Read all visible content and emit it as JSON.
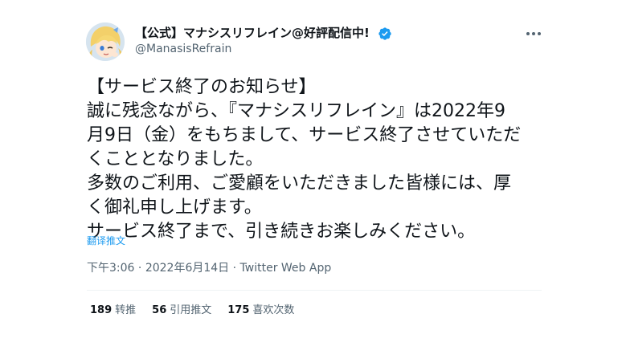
{
  "author": {
    "display_name": "【公式】マナシスリフレイン@好評配信中!",
    "handle": "@ManasisRefrain",
    "avatar_icon": "anime-character-avatar",
    "verified_icon": "verified-badge-icon",
    "verified_color": "#1d9bf0"
  },
  "tweet": {
    "lines": [
      "【サービス終了のお知らせ】",
      "誠に残念ながら、『マナシスリフレイン』は2022年9",
      "月9日（金）をもちまして、サービス終了させていただ",
      "くこととなりました。",
      "多数のご利用、ご愛顧をいただきました皆様には、厚",
      "く御礼申し上げます。",
      "サービス終了まで、引き続きお楽しみください。"
    ],
    "translate_label": "翻译推文",
    "time": "下午3:06",
    "date": "2022年6月14日",
    "separator": "·",
    "source": "Twitter Web App"
  },
  "stats": {
    "retweets_count": "189",
    "retweets_label": "转推",
    "quotes_count": "56",
    "quotes_label": "引用推文",
    "likes_count": "175",
    "likes_label": "喜欢次数"
  },
  "colors": {
    "text": "#0f1419",
    "secondary": "#536471",
    "link": "#1d9bf0",
    "divider": "#eff3f4"
  }
}
